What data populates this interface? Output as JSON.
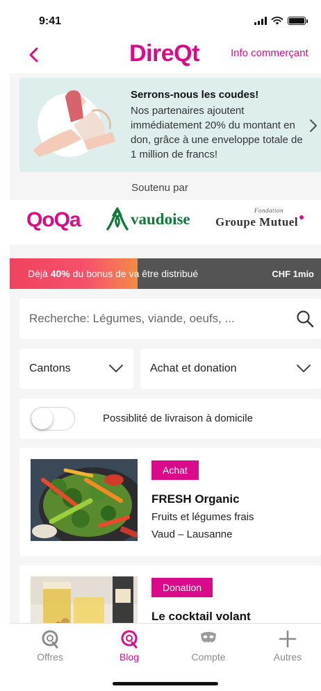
{
  "status_bar": {
    "time": "9:41"
  },
  "nav": {
    "logo": "DireQt",
    "info_link": "Info commerçant"
  },
  "banner": {
    "title": "Serrons-nous les coudes!",
    "text": "Nos partenaires ajoutent immédiatement 20% du montant en don, grâce à une enveloppe totale de 1 million de francs!"
  },
  "sponsors": {
    "label": "Soutenu par",
    "names": [
      "QoQa",
      "vaudoise",
      "Groupe Mutuel"
    ],
    "groupe_mutuel_tagline": "Fondation"
  },
  "bonus_bar": {
    "prefix": "Déjà ",
    "percent_text": "40%",
    "suffix": " du bonus de va être distribué",
    "amount": "CHF 1mio",
    "progress": 0.41
  },
  "search": {
    "placeholder": "Recherche: Légumes, viande, oeufs, ..."
  },
  "filters": {
    "canton_label": "Cantons",
    "type_label": "Achat et donation"
  },
  "delivery_toggle": {
    "label": "Possiblité de livraison à domicile",
    "on": false
  },
  "listings": [
    {
      "badge": "Achat",
      "name": "FRESH Organic",
      "description": "Fruits et légumes frais",
      "location": "Vaud – Lausanne"
    },
    {
      "badge": "Donation",
      "name": "Le cocktail volant",
      "description": "",
      "location": ""
    }
  ],
  "tabs": [
    {
      "label": "Offres",
      "icon": "q-icon",
      "active": false
    },
    {
      "label": "Blog",
      "icon": "q-icon",
      "active": true
    },
    {
      "label": "Compte",
      "icon": "mask-icon",
      "active": false
    },
    {
      "label": "Autres",
      "icon": "plus-icon",
      "active": false
    }
  ],
  "colors": {
    "brand": "#d90b8a",
    "banner_bg": "#ddeeed",
    "progress_from": "#f0425e",
    "progress_to": "#f58a46",
    "progress_track": "#545454",
    "vaudoise_green": "#117a3a"
  }
}
